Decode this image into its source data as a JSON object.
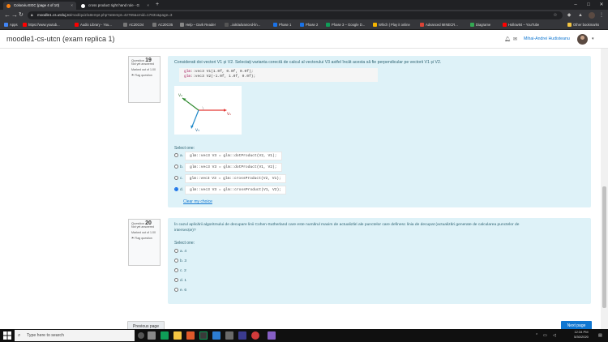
{
  "browser": {
    "tabs": [
      {
        "label": "Colocviu EGC (page 4 of 10)",
        "close": "×"
      },
      {
        "label": "cross product right hand rule - G",
        "close": "×"
      }
    ],
    "new_tab": "+",
    "window_controls": {
      "minimize": "–",
      "maximize": "□",
      "close": "✕"
    },
    "url_domain": "moodle1.cs.utcluj.ro",
    "url_path": "/mod/quiz/attempt.php?attempt=42765&cmid=17631&page=3",
    "bookmarks": [
      {
        "label": "Apps",
        "color": "#4285f4"
      },
      {
        "label": "https://www.youtub...",
        "color": "#ff0000"
      },
      {
        "label": "Audio Library - You...",
        "color": "#ff0000"
      },
      {
        "label": "AC20C04",
        "color": "#555555"
      },
      {
        "label": "AC20C05",
        "color": "#555555"
      },
      {
        "label": "Help – Dark Reader",
        "color": "#777777"
      },
      {
        "label": "..ials/advanced-lin...",
        "color": "#4a4a4a"
      },
      {
        "label": "Phase 1",
        "color": "#1a73e8"
      },
      {
        "label": "Phase 2",
        "color": "#1a73e8"
      },
      {
        "label": "Phase 3 – Google D...",
        "color": "#0f9d58"
      },
      {
        "label": "Which | Play it online",
        "color": "#f4b400"
      },
      {
        "label": "Advanced MINECR...",
        "color": "#db4437"
      },
      {
        "label": "Diagrame",
        "color": "#34a853"
      },
      {
        "label": "Hollow84 – YouTube",
        "color": "#ff0000"
      }
    ],
    "other_bookmarks": "Other bookmarks"
  },
  "site": {
    "title": "moodle1-cs-utcn (exam replica 1)",
    "user_name": "Mihai-Andrei Hudisteanu"
  },
  "questions": [
    {
      "label": "Question",
      "number": "19",
      "status": "Not yet answered",
      "marked": "Marked out of 1.00",
      "flag": "Flag question",
      "text": "Considerati doi vectori V1 și V2. Selectați varianta corectă de calcul al vectorului V3 astfel încât acesta să fie perpendicular pe vectorii V1 și V2.",
      "code_lines": [
        {
          "kw": "glm",
          "rest": "::vec3 V1(1.0f, 0.0f, 0.0f);"
        },
        {
          "kw": "glm",
          "rest": "::vec3 V2(-1.0f, 1.0f, 0.0f);"
        }
      ],
      "figure_labels": {
        "v1": "V₁",
        "v2": "V₂",
        "v3": "V₃"
      },
      "select_one": "Select one:",
      "options": [
        {
          "letter": "a.",
          "code": "glm::vec3 V3 = glm::dotProduct(V2, V1);",
          "selected": false
        },
        {
          "letter": "b.",
          "code": "glm::vec3 V3 = glm::dotProduct(V1, V2);",
          "selected": false
        },
        {
          "letter": "c.",
          "code": "glm::vec3 V3 = glm::crossProduct(V2, V1);",
          "selected": false
        },
        {
          "letter": "d.",
          "code": "glm::vec3 V3 = glm::crossProduct(V1, V2);",
          "selected": true
        }
      ],
      "clear_choice": "Clear my choice"
    },
    {
      "label": "Question",
      "number": "20",
      "status": "Not yet answered",
      "marked": "Marked out of 1.00",
      "flag": "Flag question",
      "text_line1": "În cazul aplicării algoritmului de decupare linii Cohen-Sutherland care este numărul maxim de actualizări ale punctelor care definesc linia de decupat (actualizări generate de calcularea punctelor de",
      "text_line2": "intersecție)?",
      "select_one": "Select one:",
      "options": [
        {
          "letter": "a.",
          "value": "4",
          "selected": false
        },
        {
          "letter": "b.",
          "value": "3",
          "selected": false
        },
        {
          "letter": "c.",
          "value": "2",
          "selected": false
        },
        {
          "letter": "d.",
          "value": "1",
          "selected": false
        },
        {
          "letter": "e.",
          "value": "6",
          "selected": false
        }
      ]
    }
  ],
  "nav": {
    "previous": "Previous page",
    "next": "Next page"
  },
  "taskbar": {
    "search_placeholder": "Type here to search",
    "time": "12:34 PM",
    "date": "5/30/2020"
  },
  "colors": {
    "question_bg": "#def2f8",
    "link": "#1177d1",
    "primary": "#1177d1"
  }
}
